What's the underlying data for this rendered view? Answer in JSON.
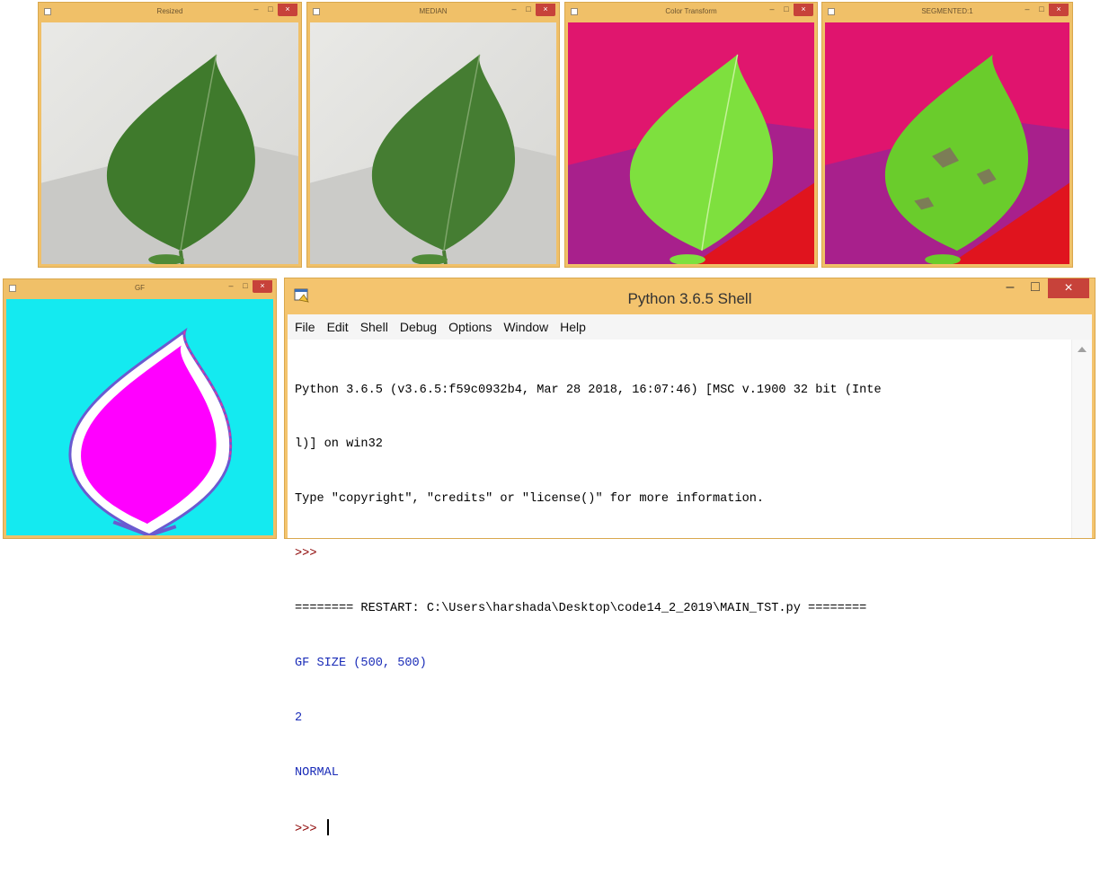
{
  "windows": [
    {
      "title": "Resized",
      "kind": "original"
    },
    {
      "title": "MEDIAN",
      "kind": "median"
    },
    {
      "title": "Color Transform",
      "kind": "color"
    },
    {
      "title": "SEGMENTED:1",
      "kind": "segmented"
    },
    {
      "title": "GF",
      "kind": "gf"
    }
  ],
  "window_controls": {
    "minimize": "–",
    "maximize": "□",
    "close": "×"
  },
  "shell": {
    "title": "Python 3.6.5 Shell",
    "menu": [
      "File",
      "Edit",
      "Shell",
      "Debug",
      "Options",
      "Window",
      "Help"
    ],
    "lines": [
      "Python 3.6.5 (v3.6.5:f59c0932b4, Mar 28 2018, 16:07:46) [MSC v.1900 32 bit (Inte",
      "l)] on win32",
      "Type \"copyright\", \"credits\" or \"license()\" for more information.",
      ">>>",
      "======== RESTART: C:\\Users\\harshada\\Desktop\\code14_2_2019\\MAIN_TST.py ========",
      "GF SIZE (500, 500)",
      "2",
      "NORMAL",
      ">>> "
    ]
  },
  "colors": {
    "title_bar": "#f0c068",
    "close_button": "#c7423a",
    "prompt": "#8b0000",
    "output": "#1a2cb8",
    "gf_background": "#14eaf0",
    "gf_leaf": "#ff00ff",
    "segment_background": "#e0146e",
    "segment_leaf": "#6acc2c"
  },
  "icons": {
    "window": "window-icon",
    "python": "idle-python-icon",
    "scroll_up": "scroll-up-arrow-icon"
  }
}
